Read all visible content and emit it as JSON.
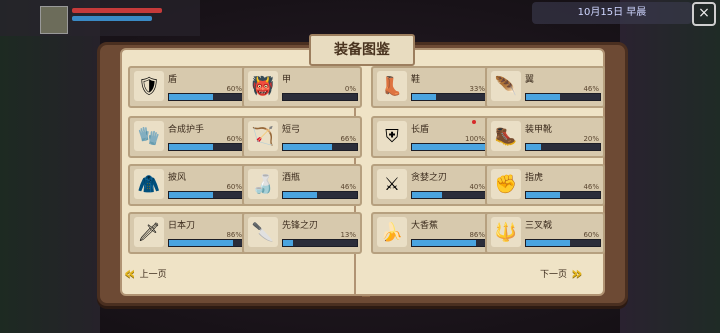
{
  "title": "装备图鉴",
  "hud": {
    "date_weather": "10月15日 早晨"
  },
  "navigation": {
    "prev_label": "上一页",
    "next_label": "下一页"
  },
  "colors": {
    "bar_fill": "#4aa4e0",
    "bar_bg": "#2b2d3a",
    "page": "#efe3c6"
  },
  "items": [
    {
      "name": "盾",
      "pct": "60%",
      "value": 60,
      "icon": "shield-icon",
      "glyph": "🛡"
    },
    {
      "name": "甲",
      "pct": "0%",
      "value": 0,
      "icon": "armor-icon",
      "glyph": "👹"
    },
    {
      "name": "鞋",
      "pct": "33%",
      "value": 33,
      "icon": "boots-icon",
      "glyph": "👢"
    },
    {
      "name": "翼",
      "pct": "46%",
      "value": 46,
      "icon": "wing-icon",
      "glyph": "🪶"
    },
    {
      "name": "合成护手",
      "pct": "60%",
      "value": 60,
      "icon": "gauntlet-icon",
      "glyph": "🧤"
    },
    {
      "name": "短弓",
      "pct": "66%",
      "value": 66,
      "icon": "bow-icon",
      "glyph": "🏹"
    },
    {
      "name": "长盾",
      "pct": "100%",
      "value": 100,
      "icon": "tower-shield-icon",
      "glyph": "⛨"
    },
    {
      "name": "装甲靴",
      "pct": "20%",
      "value": 20,
      "icon": "armored-boots-icon",
      "glyph": "🥾"
    },
    {
      "name": "披风",
      "pct": "60%",
      "value": 60,
      "icon": "cloak-icon",
      "glyph": "🧥"
    },
    {
      "name": "酒瓶",
      "pct": "46%",
      "value": 46,
      "icon": "bottle-icon",
      "glyph": "🍶"
    },
    {
      "name": "贪婪之刃",
      "pct": "40%",
      "value": 40,
      "icon": "greed-blade-icon",
      "glyph": "⚔"
    },
    {
      "name": "指虎",
      "pct": "46%",
      "value": 46,
      "icon": "knuckles-icon",
      "glyph": "✊"
    },
    {
      "name": "日本刀",
      "pct": "86%",
      "value": 86,
      "icon": "katana-icon",
      "glyph": "🗡"
    },
    {
      "name": "先锋之刃",
      "pct": "13%",
      "value": 13,
      "icon": "vanguard-blade-icon",
      "glyph": "🔪"
    },
    {
      "name": "大香蕉",
      "pct": "86%",
      "value": 86,
      "icon": "banana-icon",
      "glyph": "🍌"
    },
    {
      "name": "三叉戟",
      "pct": "60%",
      "value": 60,
      "icon": "trident-icon",
      "glyph": "🔱"
    }
  ]
}
